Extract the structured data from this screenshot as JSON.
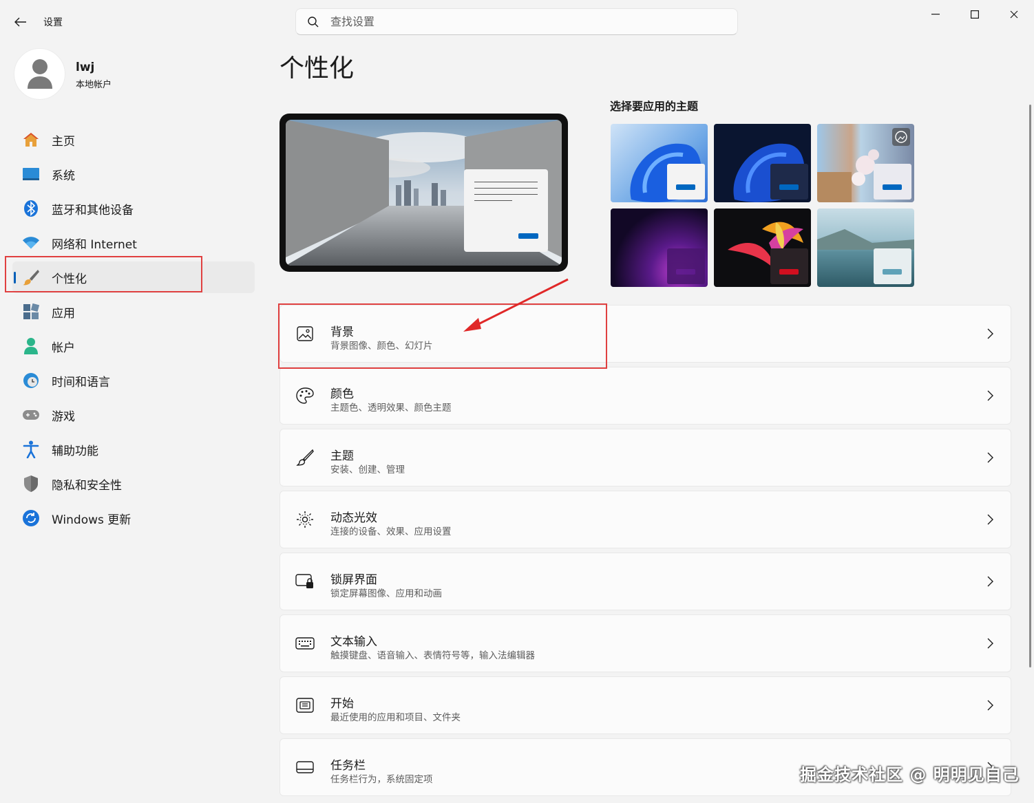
{
  "window": {
    "app_title": "设置",
    "controls": {
      "minimize": "minimize-icon",
      "maximize": "maximize-icon",
      "close": "close-icon"
    }
  },
  "search": {
    "placeholder": "查找设置",
    "value": ""
  },
  "profile": {
    "name": "lwj",
    "account_type": "本地帐户"
  },
  "sidebar": {
    "items": [
      {
        "label": "主页",
        "icon": "home-icon"
      },
      {
        "label": "系统",
        "icon": "system-icon"
      },
      {
        "label": "蓝牙和其他设备",
        "icon": "bluetooth-icon"
      },
      {
        "label": "网络和 Internet",
        "icon": "wifi-icon"
      },
      {
        "label": "个性化",
        "icon": "brush-icon",
        "selected": true
      },
      {
        "label": "应用",
        "icon": "apps-icon"
      },
      {
        "label": "帐户",
        "icon": "account-icon"
      },
      {
        "label": "时间和语言",
        "icon": "clock-globe-icon"
      },
      {
        "label": "游戏",
        "icon": "gamepad-icon"
      },
      {
        "label": "辅助功能",
        "icon": "accessibility-icon"
      },
      {
        "label": "隐私和安全性",
        "icon": "shield-icon"
      },
      {
        "label": "Windows 更新",
        "icon": "update-icon"
      }
    ]
  },
  "main": {
    "page_title": "个性化",
    "themes_heading": "选择要应用的主题",
    "themes": [
      {
        "name": "light-bloom",
        "accent": "#0067c0"
      },
      {
        "name": "dark-bloom",
        "accent": "#0067c0"
      },
      {
        "name": "spotlight",
        "accent": "#0067c0"
      },
      {
        "name": "glow",
        "accent": "#5a1a8a"
      },
      {
        "name": "captured-motion",
        "accent": "#d10f1f"
      },
      {
        "name": "flow",
        "accent": "#5fa2b8"
      }
    ],
    "settings": [
      {
        "title": "背景",
        "subtitle": "背景图像、颜色、幻灯片",
        "icon": "image-icon"
      },
      {
        "title": "颜色",
        "subtitle": "主题色、透明效果、颜色主题",
        "icon": "palette-icon"
      },
      {
        "title": "主题",
        "subtitle": "安装、创建、管理",
        "icon": "brush-icon"
      },
      {
        "title": "动态光效",
        "subtitle": "连接的设备、效果、应用设置",
        "icon": "lighting-icon"
      },
      {
        "title": "锁屏界面",
        "subtitle": "锁定屏幕图像、应用和动画",
        "icon": "lock-screen-icon"
      },
      {
        "title": "文本输入",
        "subtitle": "触摸键盘、语音输入、表情符号等，输入法编辑器",
        "icon": "keyboard-icon"
      },
      {
        "title": "开始",
        "subtitle": "最近使用的应用和项目、文件夹",
        "icon": "start-icon"
      },
      {
        "title": "任务栏",
        "subtitle": "任务栏行为，系统固定项",
        "icon": "taskbar-icon"
      }
    ]
  },
  "watermark": "掘金技术社区 @ 明明见自己",
  "colors": {
    "accent": "#005fb8",
    "annotation": "#e04040"
  }
}
